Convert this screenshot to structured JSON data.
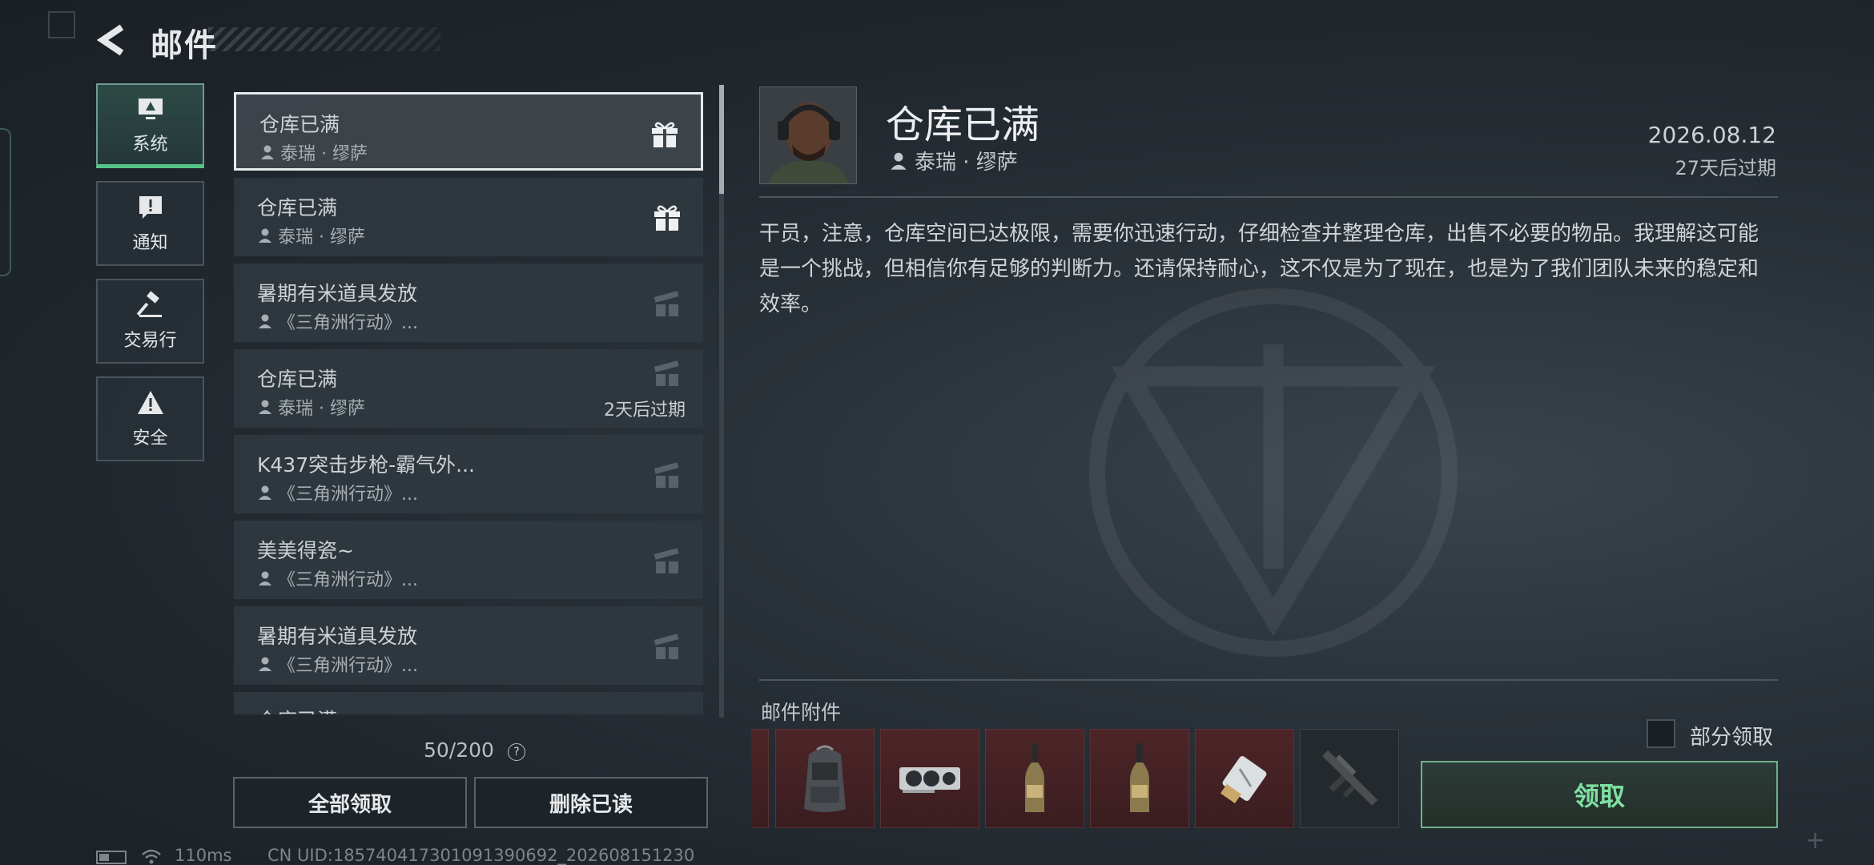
{
  "header": {
    "title": "邮件"
  },
  "categories": [
    {
      "label": "系统",
      "icon": "monitor-icon",
      "active": true
    },
    {
      "label": "通知",
      "icon": "alert-message-icon",
      "active": false
    },
    {
      "label": "交易行",
      "icon": "hammer-icon",
      "active": false
    },
    {
      "label": "安全",
      "icon": "warning-triangle-icon",
      "active": false
    }
  ],
  "mails": [
    {
      "subject": "仓库已满",
      "sender": "泰瑞 · 缪萨",
      "expiry": "",
      "gift": "active"
    },
    {
      "subject": "仓库已满",
      "sender": "泰瑞 · 缪萨",
      "expiry": "",
      "gift": "active"
    },
    {
      "subject": "暑期有米道具发放",
      "sender": "《三角洲行动》...",
      "expiry": "",
      "gift": "claimed"
    },
    {
      "subject": "仓库已满",
      "sender": "泰瑞 · 缪萨",
      "expiry": "2天后过期",
      "gift": "claimed"
    },
    {
      "subject": "K437突击步枪-霸气外...",
      "sender": "《三角洲行动》...",
      "expiry": "",
      "gift": "claimed"
    },
    {
      "subject": "美美得瓷~",
      "sender": "《三角洲行动》...",
      "expiry": "",
      "gift": "claimed"
    },
    {
      "subject": "暑期有米道具发放",
      "sender": "《三角洲行动》...",
      "expiry": "",
      "gift": "claimed"
    },
    {
      "subject": "仓库已满",
      "sender": "",
      "expiry": "",
      "gift": "claimed"
    }
  ],
  "mail_count": "50/200",
  "help": "?",
  "actions": {
    "claim_all": "全部领取",
    "delete_read": "删除已读"
  },
  "status": {
    "ping": "110ms",
    "uid": "CN UID:185740417301091390692_202608151230"
  },
  "detail": {
    "title": "仓库已满",
    "sender": "泰瑞 · 缪萨",
    "date": "2026.08.12",
    "expire": "27天后过期",
    "body": "干员，注意，仓库空间已达极限，需要你迅速行动，仔细检查并整理仓库，出售不必要的物品。我理解这可能是一个挑战，但相信你有足够的判断力。还请保持耐心，这不仅是为了现在，也是为了我们团队未来的稳定和效率。"
  },
  "attachments": {
    "label": "邮件附件",
    "items": [
      "backpack-icon",
      "graphics-card-icon",
      "champagne-bottle-icon",
      "champagne-bottle-icon",
      "usb-drive-icon",
      "rifle-icon"
    ]
  },
  "partial_claim": "部分领取",
  "claim": "领取",
  "colors": {
    "accent_green": "#56c486",
    "claim_text": "#7fe0a2",
    "attachment_bg": "#4d2528"
  }
}
